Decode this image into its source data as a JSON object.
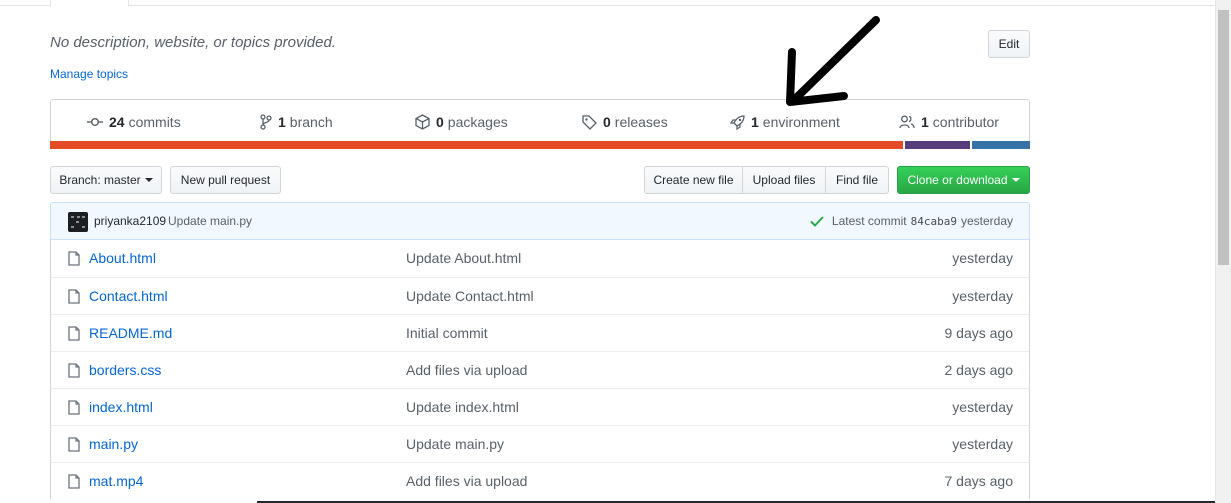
{
  "repo": {
    "description": "No description, website, or topics provided.",
    "manage_topics": "Manage topics",
    "edit_label": "Edit"
  },
  "summary": {
    "commits": {
      "count": "24",
      "label": "commits"
    },
    "branches": {
      "count": "1",
      "label": "branch"
    },
    "packages": {
      "count": "0",
      "label": "packages"
    },
    "releases": {
      "count": "0",
      "label": "releases"
    },
    "environments": {
      "count": "1",
      "label": "environment"
    },
    "contributors": {
      "count": "1",
      "label": "contributor"
    }
  },
  "language_bar": [
    {
      "color": "#e34c26",
      "fraction": 0.867
    },
    {
      "color": "#563d7c",
      "fraction": 0.068
    },
    {
      "color": "#3572A5",
      "fraction": 0.061
    }
  ],
  "toolbar": {
    "branch_label": "Branch: master",
    "new_pr_label": "New pull request",
    "create_file_label": "Create new file",
    "upload_files_label": "Upload files",
    "find_file_label": "Find file",
    "clone_label": "Clone or download"
  },
  "latest_commit": {
    "author": "priyanka2109",
    "message": "Update main.py",
    "prefix": "Latest commit",
    "sha": "84caba9",
    "when": "yesterday"
  },
  "files": [
    {
      "name": "About.html",
      "message": "Update About.html",
      "age": "yesterday"
    },
    {
      "name": "Contact.html",
      "message": "Update Contact.html",
      "age": "yesterday"
    },
    {
      "name": "README.md",
      "message": "Initial commit",
      "age": "9 days ago"
    },
    {
      "name": "borders.css",
      "message": "Add files via upload",
      "age": "2 days ago"
    },
    {
      "name": "index.html",
      "message": "Update index.html",
      "age": "yesterday"
    },
    {
      "name": "main.py",
      "message": "Update main.py",
      "age": "yesterday"
    },
    {
      "name": "mat.mp4",
      "message": "Add files via upload",
      "age": "7 days ago"
    }
  ],
  "colors": {
    "link": "#0366d6",
    "green_button": "#28a745",
    "commit_bar": "#f1f8ff",
    "check": "#28a745"
  }
}
